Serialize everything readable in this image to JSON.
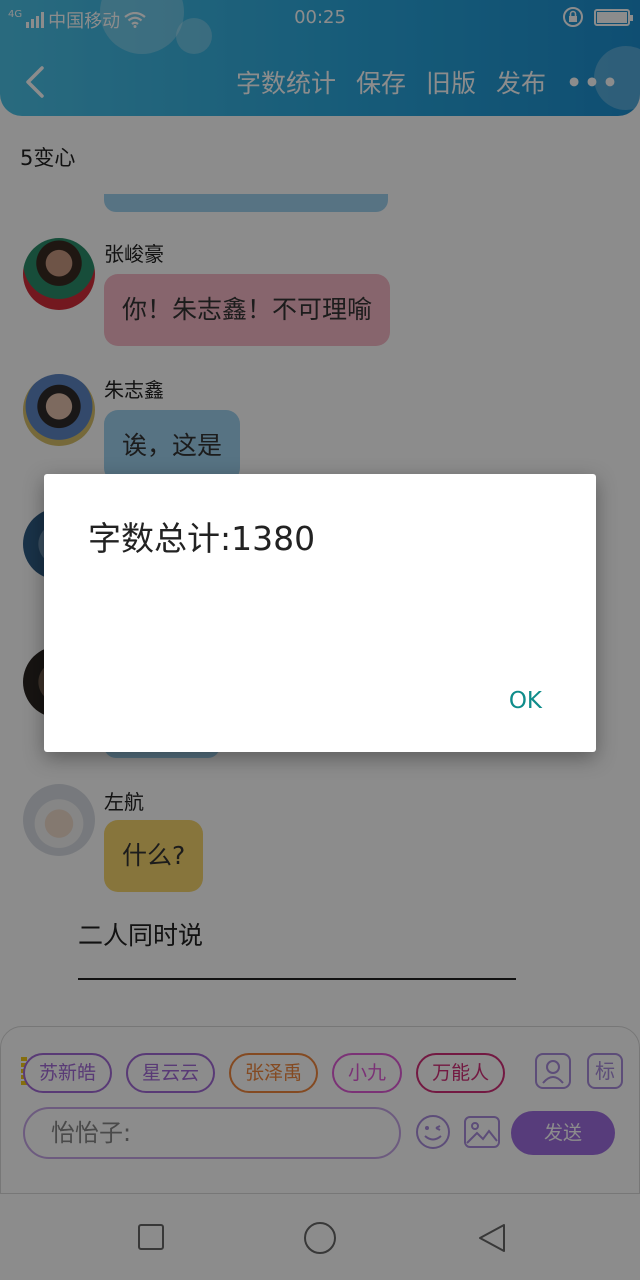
{
  "status_bar": {
    "network": "4G",
    "carrier": "中国移动",
    "time": "00:25"
  },
  "header": {
    "actions": [
      "字数统计",
      "保存",
      "旧版",
      "发布"
    ],
    "more_label": "•••"
  },
  "story": {
    "title": "5变心",
    "messages": [
      {
        "speaker": "张峻豪",
        "text": "你！朱志鑫！不可理喻",
        "bubble_color": "#f6b9c6"
      },
      {
        "speaker": "朱志鑫",
        "text": "诶，这是",
        "bubble_color": "#9fd2ef"
      },
      {
        "speaker": "左航",
        "text": "什么?",
        "bubble_color": "#f6d56d"
      }
    ],
    "narration": "二人同时说"
  },
  "characters": [
    {
      "name": "苏新皓",
      "color": "#a36ad8"
    },
    {
      "name": "星云云",
      "color": "#a36ad8"
    },
    {
      "name": "张泽禹",
      "color": "#f0883e"
    },
    {
      "name": "小九",
      "color": "#e05bd8"
    },
    {
      "name": "万能人",
      "color": "#d12f78"
    }
  ],
  "toolbar": {
    "tag_label": "标",
    "input_placeholder": "怡怡子:",
    "send_label": "发送"
  },
  "dialog": {
    "message": "字数总计:1380",
    "ok_label": "OK"
  },
  "colors": {
    "header_accent": "#2aa7dc",
    "send_button": "#9f6ee0",
    "ok_text": "#0f8c8a"
  }
}
